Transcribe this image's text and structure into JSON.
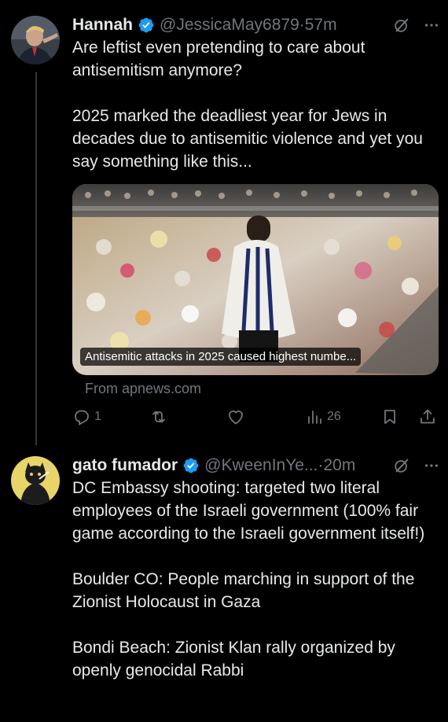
{
  "tweets": [
    {
      "display_name": "Hannah",
      "handle": "@JessicaMay6879",
      "separator": "·",
      "time": "57m",
      "text": [
        "Are leftist even pretending to care about antisemitism anymore?",
        "2025 marked the deadliest year for Jews in decades due to antisemitic violence and yet you say something like this..."
      ],
      "card": {
        "caption": "Antisemitic attacks in 2025 caused highest numbe...",
        "source": "From apnews.com"
      },
      "actions": {
        "replies": "1",
        "reposts": "",
        "likes": "",
        "views": "26"
      }
    },
    {
      "display_name": "gato fumador",
      "handle": "@KweenInYe...",
      "separator": "·",
      "time": "20m",
      "text": [
        "DC Embassy shooting: targeted two literal employees of the Israeli government (100% fair game according to the Israeli government itself!)",
        "Boulder CO: People marching in support of the Zionist Holocaust in Gaza",
        "Bondi Beach: Zionist Klan rally organized by openly genocidal Rabbi"
      ]
    }
  ],
  "icons": {
    "verified": "verified-badge-icon",
    "grok": "grok-icon",
    "more": "more-icon",
    "reply": "reply-icon",
    "repost": "repost-icon",
    "like": "like-icon",
    "views": "views-icon",
    "bookmark": "bookmark-icon",
    "share": "share-icon"
  },
  "colors": {
    "background": "#000000",
    "text": "#e7e9ea",
    "secondary": "#71767b",
    "verified": "#1d9bf0"
  }
}
